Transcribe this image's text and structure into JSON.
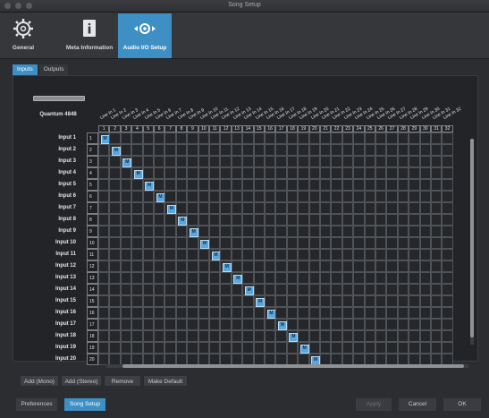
{
  "window": {
    "title": "Song Setup"
  },
  "top_tabs": [
    {
      "label": "General",
      "icon": "gear-icon"
    },
    {
      "label": "Meta Information",
      "icon": "info-icon"
    },
    {
      "label": "Audio I/O Setup",
      "icon": "audio-io-icon"
    }
  ],
  "sub_tabs": [
    {
      "label": "Inputs"
    },
    {
      "label": "Outputs"
    }
  ],
  "device": {
    "name": "Quantum 4848"
  },
  "columns": [
    "Line In 1",
    "Line In 2",
    "Line In 3",
    "Line In 4",
    "Line In 5",
    "Line In 6",
    "Line In 7",
    "Line In 8",
    "Line In 9",
    "Line In 10",
    "Line In 11",
    "Line In 12",
    "Line In 13",
    "Line In 14",
    "Line In 15",
    "Line In 16",
    "Line In 17",
    "Line In 18",
    "Line In 19",
    "Line In 20",
    "Line In 21",
    "Line In 22",
    "Line In 23",
    "Line In 24",
    "Line In 25",
    "Line In 26",
    "Line In 27",
    "Line In 28",
    "Line In 29",
    "Line In 30",
    "Line In 31",
    "Line In 32"
  ],
  "column_numbers": [
    "1",
    "2",
    "3",
    "4",
    "5",
    "6",
    "7",
    "8",
    "9",
    "10",
    "11",
    "12",
    "13",
    "14",
    "15",
    "16",
    "17",
    "18",
    "19",
    "20",
    "21",
    "22",
    "23",
    "24",
    "25",
    "26",
    "27",
    "28",
    "29",
    "30",
    "31",
    "32"
  ],
  "rows": [
    {
      "label": "Input 1",
      "num": "1",
      "assigned": 1
    },
    {
      "label": "Input 2",
      "num": "2",
      "assigned": 2
    },
    {
      "label": "Input 3",
      "num": "3",
      "assigned": 3
    },
    {
      "label": "Input 4",
      "num": "4",
      "assigned": 4
    },
    {
      "label": "Input 5",
      "num": "5",
      "assigned": 5
    },
    {
      "label": "Input 6",
      "num": "6",
      "assigned": 6
    },
    {
      "label": "Input 7",
      "num": "7",
      "assigned": 7
    },
    {
      "label": "Input 8",
      "num": "8",
      "assigned": 8
    },
    {
      "label": "Input 9",
      "num": "9",
      "assigned": 9
    },
    {
      "label": "Input 10",
      "num": "10",
      "assigned": 10
    },
    {
      "label": "Input 11",
      "num": "11",
      "assigned": 11
    },
    {
      "label": "Input 12",
      "num": "12",
      "assigned": 12
    },
    {
      "label": "Input 13",
      "num": "13",
      "assigned": 13
    },
    {
      "label": "Input 14",
      "num": "14",
      "assigned": 14
    },
    {
      "label": "Input 15",
      "num": "15",
      "assigned": 15
    },
    {
      "label": "Input 16",
      "num": "16",
      "assigned": 16
    },
    {
      "label": "Input 17",
      "num": "17",
      "assigned": 17
    },
    {
      "label": "Input 18",
      "num": "18",
      "assigned": 18
    },
    {
      "label": "Input 19",
      "num": "19",
      "assigned": 19
    },
    {
      "label": "Input 20",
      "num": "20",
      "assigned": 20
    }
  ],
  "assignment_mark": "M",
  "buttons": {
    "add_mono": "Add (Mono)",
    "add_stereo": "Add (Stereo)",
    "remove": "Remove",
    "make_default": "Make Default"
  },
  "footer": {
    "preferences": "Preferences",
    "song_setup": "Song Setup",
    "apply": "Apply",
    "cancel": "Cancel",
    "ok": "OK"
  },
  "colors": {
    "accent": "#3d8fc4",
    "mark": "#5aa7de"
  }
}
